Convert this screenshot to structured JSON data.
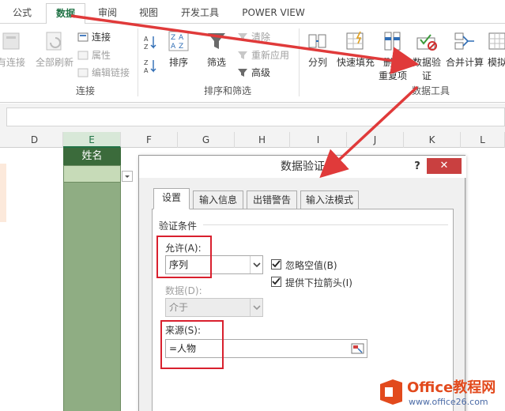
{
  "tabs": [
    "公式",
    "数据",
    "审阅",
    "视图",
    "开发工具",
    "POWER VIEW"
  ],
  "ribbon": {
    "existing_connections": "有连接",
    "refresh_all": "全部刷新",
    "connections": "连接",
    "properties": "属性",
    "edit_links": "编辑链接",
    "group_connections": "连接",
    "sort": "排序",
    "filter": "筛选",
    "clear": "清除",
    "reapply": "重新应用",
    "advanced": "高级",
    "group_sort_filter": "排序和筛选",
    "split": "分列",
    "flash_fill": "快速填充",
    "remove_dup_line1": "删除",
    "remove_dup_line2": "重复项",
    "data_validation_line1": "数据验",
    "data_validation_line2": "证",
    "consolidate": "合并计算",
    "what_if": "模拟",
    "group_data_tools": "数据工具"
  },
  "columns": [
    "D",
    "E",
    "F",
    "G",
    "H",
    "I",
    "J",
    "K",
    "L"
  ],
  "cell_header": "姓名",
  "dialog": {
    "title": "数据验证",
    "help": "?",
    "close": "✕",
    "tabs": [
      "设置",
      "输入信息",
      "出错警告",
      "输入法模式"
    ],
    "section": "验证条件",
    "allow_label": "允许(A):",
    "allow_value": "序列",
    "ignore_blank": "忽略空值(B)",
    "dropdown": "提供下拉箭头(I)",
    "data_label": "数据(D):",
    "data_value": "介于",
    "source_label": "来源(S):",
    "source_value": "=人物"
  },
  "watermark": {
    "brand": "Office教程网",
    "url": "www.office26.com"
  },
  "colors": {
    "excel_green": "#217346",
    "highlight_red": "#d9202e",
    "column_fill": "#8fad83"
  }
}
